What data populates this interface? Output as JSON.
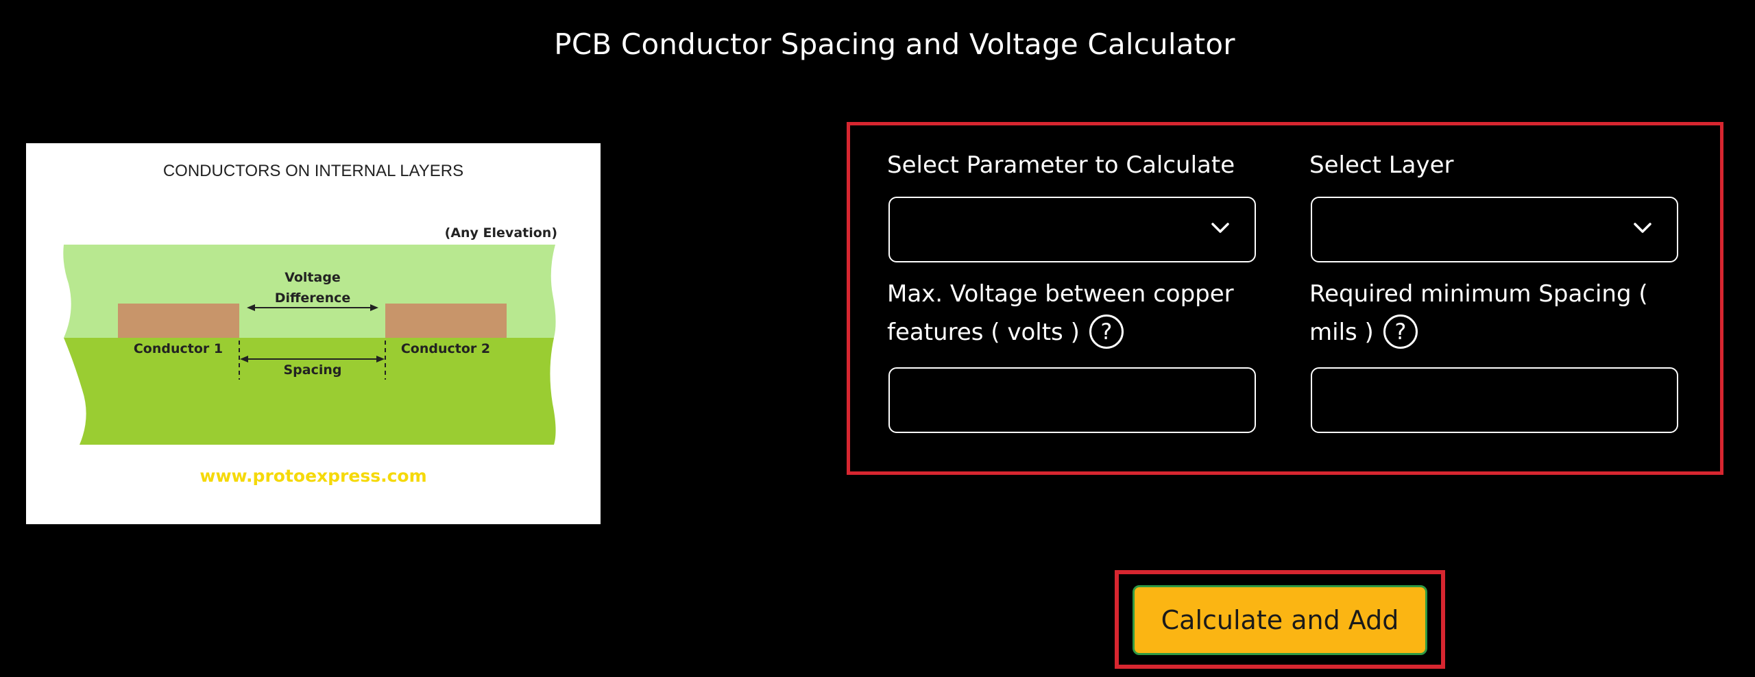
{
  "header": {
    "title": "PCB Conductor Spacing and Voltage Calculator"
  },
  "diagram": {
    "title": "CONDUCTORS ON INTERNAL LAYERS",
    "elevation_label": "(Any Elevation)",
    "voltage_label_line1": "Voltage",
    "voltage_label_line2": "Difference",
    "conductor1_label": "Conductor 1",
    "conductor2_label": "Conductor 2",
    "spacing_label": "Spacing",
    "website": "www.protoexpress.com",
    "colors": {
      "light_layer": "#b8e890",
      "dark_layer": "#9acd32",
      "conductor": "#c8956a",
      "website_text": "#f5d90a"
    }
  },
  "form": {
    "parameter_label": "Select Parameter to Calculate",
    "parameter_value": "",
    "layer_label": "Select Layer",
    "layer_value": "",
    "voltage_label_line1": "Max. Voltage between copper",
    "voltage_label_line2": "features ( volts )",
    "voltage_value": "",
    "spacing_label_line1": "Required minimum Spacing (",
    "spacing_label_line2": "mils )",
    "spacing_value": "",
    "help_symbol": "?"
  },
  "actions": {
    "calculate_label": "Calculate and Add"
  },
  "colors": {
    "highlight_border": "#d72630",
    "button_bg": "#fbb513",
    "button_border": "#2f9a44"
  }
}
